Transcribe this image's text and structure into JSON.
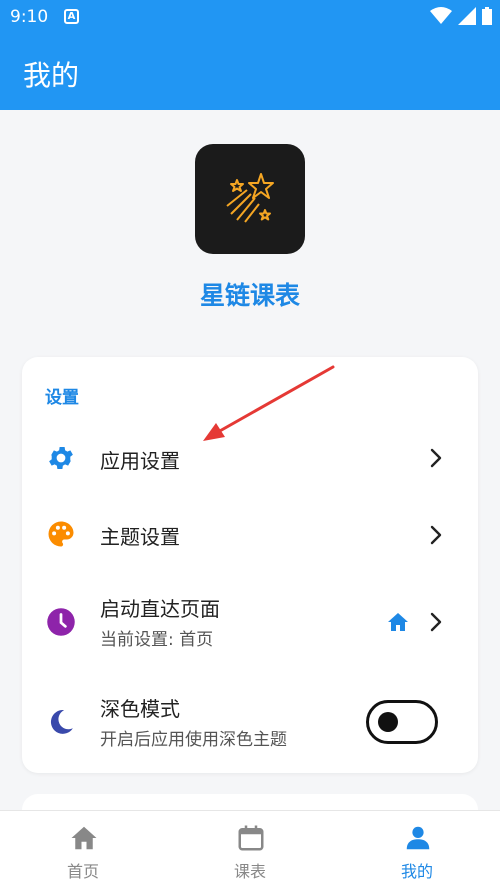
{
  "status_bar": {
    "time": "9:10",
    "notification_badge": "A"
  },
  "app_bar": {
    "title": "我的"
  },
  "app": {
    "name": "星链课表",
    "logo_icon": "shooting-stars-icon"
  },
  "settings": {
    "section_title": "设置",
    "items": [
      {
        "label": "应用设置",
        "icon": "gear-icon",
        "icon_color": "#1e88e5"
      },
      {
        "label": "主题设置",
        "icon": "palette-icon",
        "icon_color": "#fb8c00"
      },
      {
        "label": "启动直达页面",
        "subtitle": "当前设置: 首页",
        "icon": "clock-icon",
        "icon_color": "#8e24aa",
        "value_icon": "home-icon"
      },
      {
        "label": "深色模式",
        "subtitle": "开启后应用使用深色主题",
        "icon": "moon-icon",
        "icon_color": "#3949ab",
        "toggle_on": false
      }
    ]
  },
  "bottom_nav": {
    "items": [
      {
        "label": "首页",
        "icon": "home-icon",
        "active": false
      },
      {
        "label": "课表",
        "icon": "calendar-icon",
        "active": false
      },
      {
        "label": "我的",
        "icon": "person-icon",
        "active": true
      }
    ]
  },
  "colors": {
    "primary": "#2196f3",
    "accent_text": "#1e88e5",
    "annotation_arrow": "#e53935"
  }
}
